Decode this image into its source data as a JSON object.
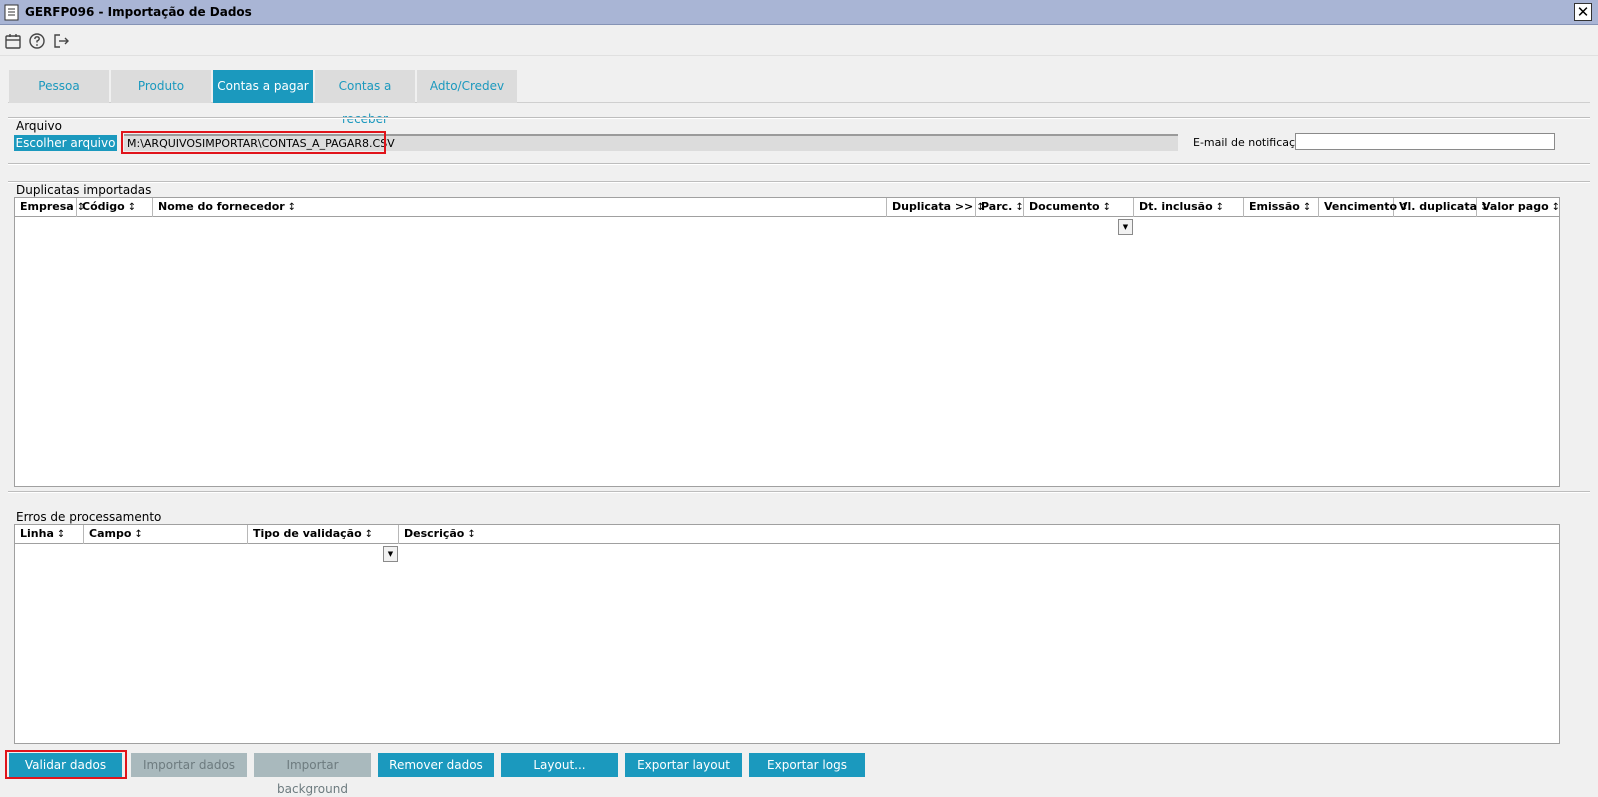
{
  "window": {
    "title": "GERFP096 - Importação de Dados",
    "close_label": "✕"
  },
  "toolbar": {
    "icons": [
      "calendar-icon",
      "help-icon",
      "exit-icon"
    ]
  },
  "tabs": [
    {
      "label": "Pessoa",
      "active": false
    },
    {
      "label": "Produto",
      "active": false
    },
    {
      "label": "Contas a pagar",
      "active": true
    },
    {
      "label": "Contas a receber",
      "active": false
    },
    {
      "label": "Adto/Credev",
      "active": false
    }
  ],
  "arquivo": {
    "section_label": "Arquivo",
    "choose_button": "Escolher arquivo",
    "file_path": "M:\\ARQUIVOSIMPORTAR\\CONTAS_A_PAGAR8.CSV",
    "email_label": "E-mail de notificação",
    "email_value": ""
  },
  "duplicatas": {
    "section_label": "Duplicatas importadas",
    "columns": [
      "Empresa",
      "Código",
      "Nome do fornecedor",
      "Duplicata >>",
      "Parc.",
      "Documento",
      "Dt. inclusão",
      "Emissão",
      "Vencimento",
      "Vl. duplicata",
      "Valor pago"
    ],
    "sort_glyph": "↕"
  },
  "erros": {
    "section_label": "Erros de processamento",
    "columns": [
      "Linha",
      "Campo",
      "Tipo de validação",
      "Descrição"
    ],
    "sort_glyph": "↕"
  },
  "footer": {
    "buttons": [
      {
        "label": "Validar dados",
        "enabled": true
      },
      {
        "label": "Importar dados",
        "enabled": false
      },
      {
        "label": "Importar background",
        "enabled": false
      },
      {
        "label": "Remover dados",
        "enabled": true
      },
      {
        "label": "Layout...",
        "enabled": true
      },
      {
        "label": "Exportar layout",
        "enabled": true
      },
      {
        "label": "Exportar logs",
        "enabled": true
      }
    ]
  },
  "colors": {
    "accent": "#1b99be",
    "titlebar": "#a9b5d5",
    "highlight": "#e0141b",
    "tab_inactive": "#dcdcdc",
    "disabled": "#a9b9bd"
  }
}
